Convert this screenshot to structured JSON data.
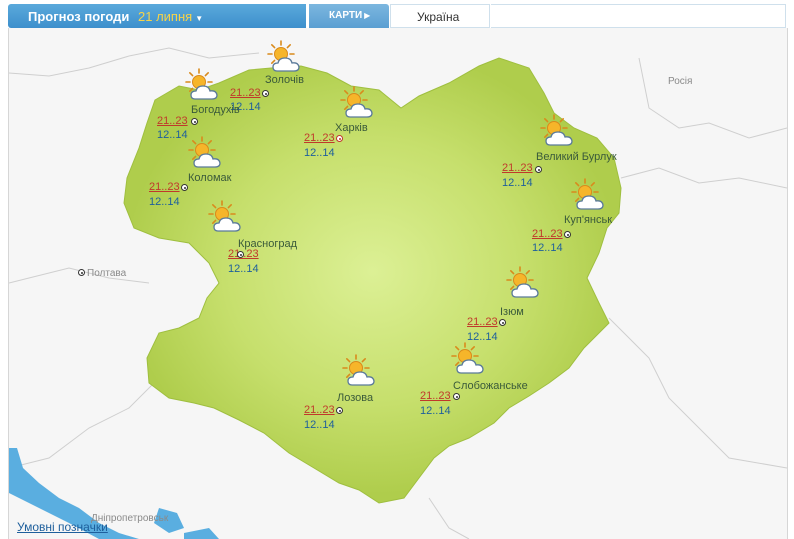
{
  "header": {
    "title": "Прогноз погоди",
    "date": "21 липня",
    "maps_label": "КАРТИ",
    "region_tab": "Україна"
  },
  "neighbors": [
    {
      "name": "Росія"
    },
    {
      "name": "Полтава"
    },
    {
      "name": "Дніпропетровськ"
    }
  ],
  "cities": [
    {
      "name": "Золочів",
      "max": "21..23",
      "min": "12..14",
      "icon": "sun-cloud-icon"
    },
    {
      "name": "Богодухів",
      "max": "21..23",
      "min": "12..14",
      "icon": "sun-cloud-icon"
    },
    {
      "name": "Харків",
      "max": "21..23",
      "min": "12..14",
      "icon": "sun-cloud-icon",
      "capital": true
    },
    {
      "name": "Коломак",
      "max": "21..23",
      "min": "12..14",
      "icon": "sun-cloud-icon"
    },
    {
      "name": "Великий Бурлук",
      "max": "21..23",
      "min": "12..14",
      "icon": "sun-cloud-icon"
    },
    {
      "name": "Куп'янськ",
      "max": "21..23",
      "min": "12..14",
      "icon": "sun-cloud-icon"
    },
    {
      "name": "Красноград",
      "max": "21..23",
      "min": "12..14",
      "icon": "sun-cloud-icon"
    },
    {
      "name": "Ізюм",
      "max": "21..23",
      "min": "12..14",
      "icon": "sun-cloud-icon"
    },
    {
      "name": "Лозова",
      "max": "21..23",
      "min": "12..14",
      "icon": "sun-cloud-icon"
    },
    {
      "name": "Слобожанське",
      "max": "21..23",
      "min": "12..14",
      "icon": "sun-cloud-icon"
    }
  ],
  "footer": {
    "legend_link": "Умовні позначки"
  },
  "colors": {
    "region_fill": "#b6d455",
    "region_center": "#d9ee8e",
    "water": "#5aaee0",
    "max_temp": "#c0392b",
    "min_temp": "#1e5f9c"
  }
}
